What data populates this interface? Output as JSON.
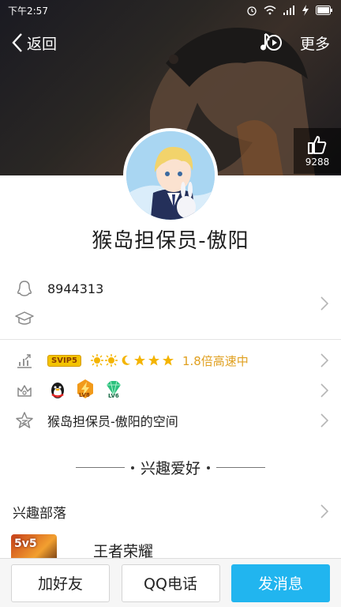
{
  "status_bar": {
    "time": "下午2:57"
  },
  "nav": {
    "back_label": "返回",
    "more_label": "更多"
  },
  "like": {
    "count": "9288"
  },
  "profile": {
    "nickname": "猴岛担保员-傲阳"
  },
  "info": {
    "qq_number": "8944313",
    "school": ""
  },
  "vip": {
    "svip_badge": "SVIP5",
    "speed_text": "1.8倍高速中"
  },
  "badges": {
    "lv_label_1": "LV8",
    "lv_label_2": "LV6"
  },
  "space": {
    "label": "猴岛担保员-傲阳的空间"
  },
  "interests": {
    "title": "兴趣爱好",
    "tribe_label": "兴趣部落",
    "game_thumb_text": "5v5",
    "game_name": "王者荣耀"
  },
  "actions": {
    "add_friend": "加好友",
    "qq_call": "QQ电话",
    "send_message": "发消息"
  },
  "colors": {
    "accent": "#21b5ef",
    "vip_gold": "#e0a020"
  }
}
